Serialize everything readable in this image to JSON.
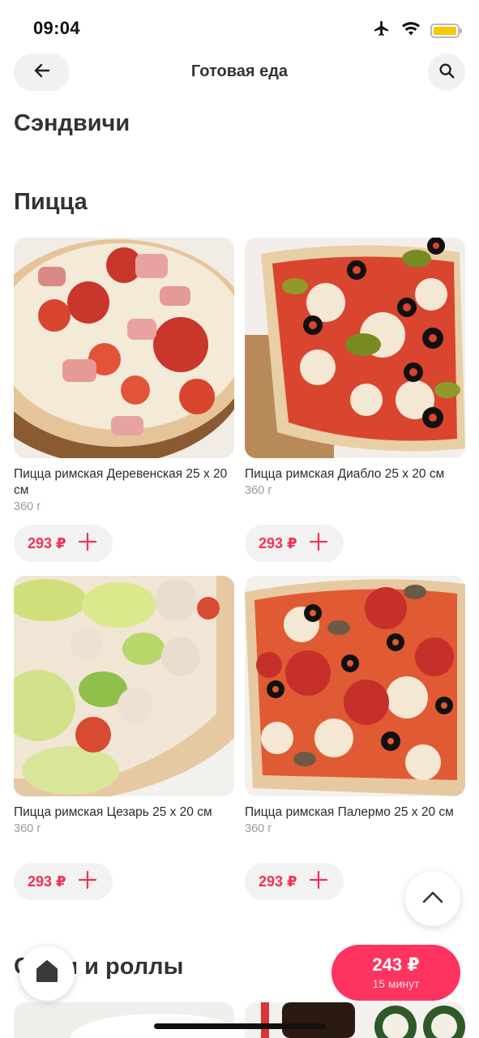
{
  "status_bar": {
    "time": "09:04",
    "icons": [
      "airplane-icon",
      "wifi-icon",
      "battery-icon"
    ],
    "battery_color": "#f5c800"
  },
  "header": {
    "title": "Готовая еда",
    "back_icon": "arrow-left-icon",
    "search_icon": "search-icon"
  },
  "sections": {
    "sandwiches": "Сэндвичи",
    "pizza": "Пицца",
    "sushi": "Суши и роллы"
  },
  "products": [
    {
      "name": "Пицца римская Деревенская 25 х 20 см",
      "weight": "360 г",
      "price": "293 ₽"
    },
    {
      "name": "Пицца римская Диабло 25 х 20 см",
      "weight": "360 г",
      "price": "293 ₽"
    },
    {
      "name": "Пицца римская Цезарь 25 х 20 см",
      "weight": "360 г",
      "price": "293 ₽"
    },
    {
      "name": "Пицца римская Палермо 25 х 20 см",
      "weight": "360 г",
      "price": "293 ₽"
    }
  ],
  "cart": {
    "total": "243 ₽",
    "eta": "15 минут"
  },
  "colors": {
    "accent": "#ff335f",
    "price": "#f0325a",
    "chip_bg": "#f2f2f2"
  }
}
